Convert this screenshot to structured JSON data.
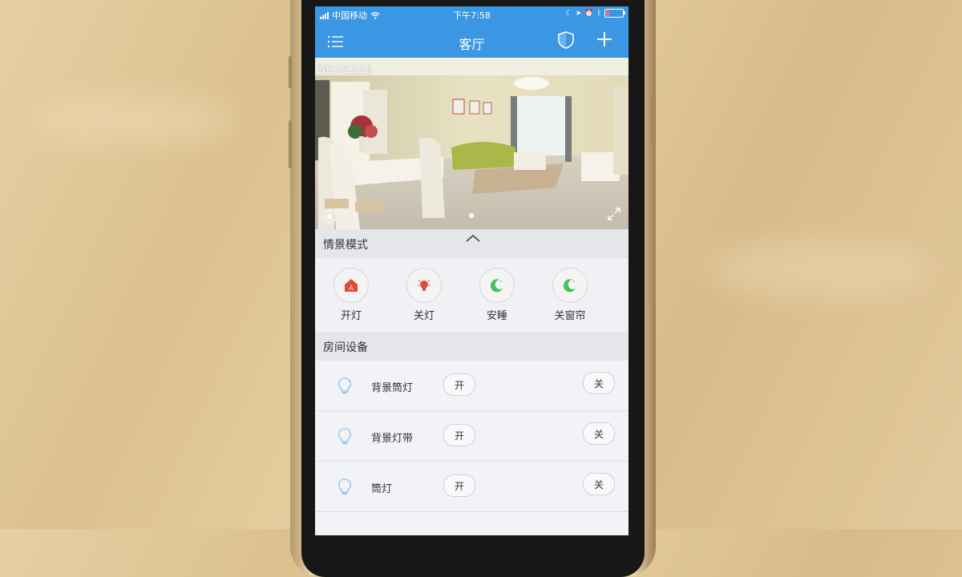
{
  "status_bar": {
    "carrier": "中国移动",
    "time": "下午7:58",
    "battery_level": 0.2,
    "battery_color": "#ff6a6a"
  },
  "nav": {
    "title": "客厅",
    "menu_icon": "list-menu-icon",
    "shield_icon": "shield-icon",
    "add_icon": "plus-icon",
    "color": "#3b97e4"
  },
  "camera": {
    "date": "2017/12/15"
  },
  "scenes": {
    "title": "情景模式",
    "items": [
      {
        "label": "开灯",
        "icon": "home-light-icon",
        "color": "#e04a3a"
      },
      {
        "label": "关灯",
        "icon": "bulb-off-icon",
        "color": "#e04a3a"
      },
      {
        "label": "安睡",
        "icon": "moon-icon",
        "color": "#46c25a"
      },
      {
        "label": "关窗帘",
        "icon": "moon-icon",
        "color": "#46c25a"
      }
    ]
  },
  "devices": {
    "title": "房间设备",
    "on_label": "开",
    "off_label": "关",
    "items": [
      {
        "name": "背景筒灯"
      },
      {
        "name": "背景灯带"
      },
      {
        "name": "筒灯"
      }
    ]
  }
}
